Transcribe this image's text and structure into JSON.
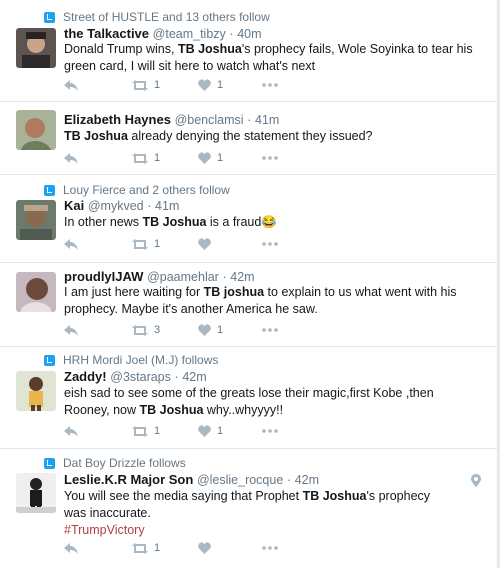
{
  "tweets": [
    {
      "context": "Street of HUSTLE and 13 others follow",
      "name": "the Talkactive",
      "handle": "@team_tibzy",
      "time": "40m",
      "text_parts": [
        "Donald Trump wins, ",
        "TB Joshua",
        "'s prophecy fails, Wole Soyinka to tear his green card, I will sit here to watch what's next"
      ],
      "retweets": "1",
      "likes": "1"
    },
    {
      "context": "",
      "name": "Elizabeth Haynes",
      "handle": "@benclamsi",
      "time": "41m",
      "text_parts": [
        "",
        "TB Joshua",
        " already denying the statement they issued?"
      ],
      "retweets": "1",
      "likes": "1"
    },
    {
      "context": "Louy Fierce and 2 others follow",
      "name": "Kai",
      "handle": "@mykved",
      "time": "41m",
      "text_parts": [
        "In other news ",
        "TB Joshua",
        " is a fraud😂"
      ],
      "retweets": "1",
      "likes": ""
    },
    {
      "context": "",
      "name": "proudlyIJAW",
      "handle": "@paamehlar",
      "time": "42m",
      "text_parts": [
        "I am just here waiting for ",
        "TB joshua",
        " to explain to us what went with his prophecy. Maybe it's another America he saw."
      ],
      "retweets": "3",
      "likes": "1"
    },
    {
      "context": "HRH Mordi Joel (M.J) follows",
      "name": "Zaddy!",
      "handle": "@3staraps",
      "time": "42m",
      "text_parts": [
        "eish sad to see some of the greats lose their magic,first Kobe ,then Rooney, now ",
        "TB Joshua",
        " why..whyyyy!!"
      ],
      "retweets": "1",
      "likes": "1"
    },
    {
      "context": "Dat Boy Drizzle follows",
      "name": "Leslie.K.R Major Son",
      "handle": "@leslie_rocque",
      "time": "42m",
      "text_parts": [
        "You will see the media saying that Prophet ",
        "TB Joshua",
        "'s prophecy was inaccurate."
      ],
      "hashtag": "#TrumpVictory",
      "retweets": "1",
      "likes": ""
    }
  ],
  "icons": {
    "reply": "reply-icon",
    "retweet": "retweet-icon",
    "like": "heart-icon",
    "more": "more-icon",
    "context": "follow-context-icon",
    "location": "location-pin-icon"
  },
  "colors": {
    "link_blue": "#1da1f2",
    "hashtag": "#b0413e",
    "muted": "#657786"
  }
}
